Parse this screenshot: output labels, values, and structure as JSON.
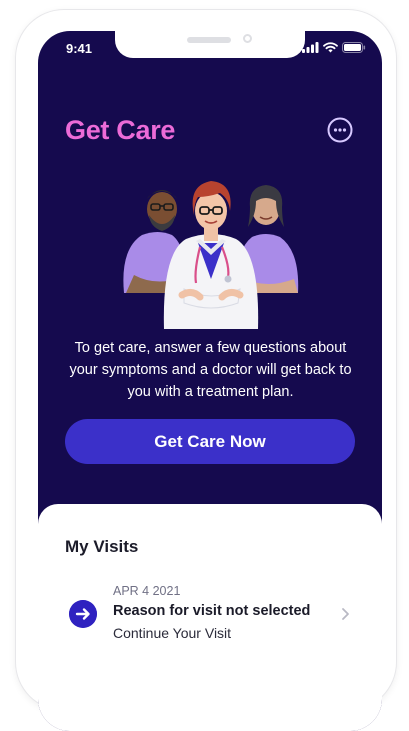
{
  "status_bar": {
    "time": "9:41"
  },
  "header": {
    "title": "Get Care",
    "more_icon": "more-dots-icon"
  },
  "hero": {
    "illustration": "doctors-illustration",
    "description": "To get care, answer a few questions about your symptoms and a doctor will get back to you with a treatment plan.",
    "cta_label": "Get Care Now"
  },
  "visits": {
    "title": "My Visits",
    "items": [
      {
        "date": "APR 4 2021",
        "reason": "Reason for visit not selected",
        "action": "Continue Your Visit",
        "icon": "arrow-right-icon"
      }
    ]
  },
  "colors": {
    "background": "#150a4e",
    "accent": "#ec6bd8",
    "button": "#3b30c9",
    "card": "#ffffff"
  }
}
